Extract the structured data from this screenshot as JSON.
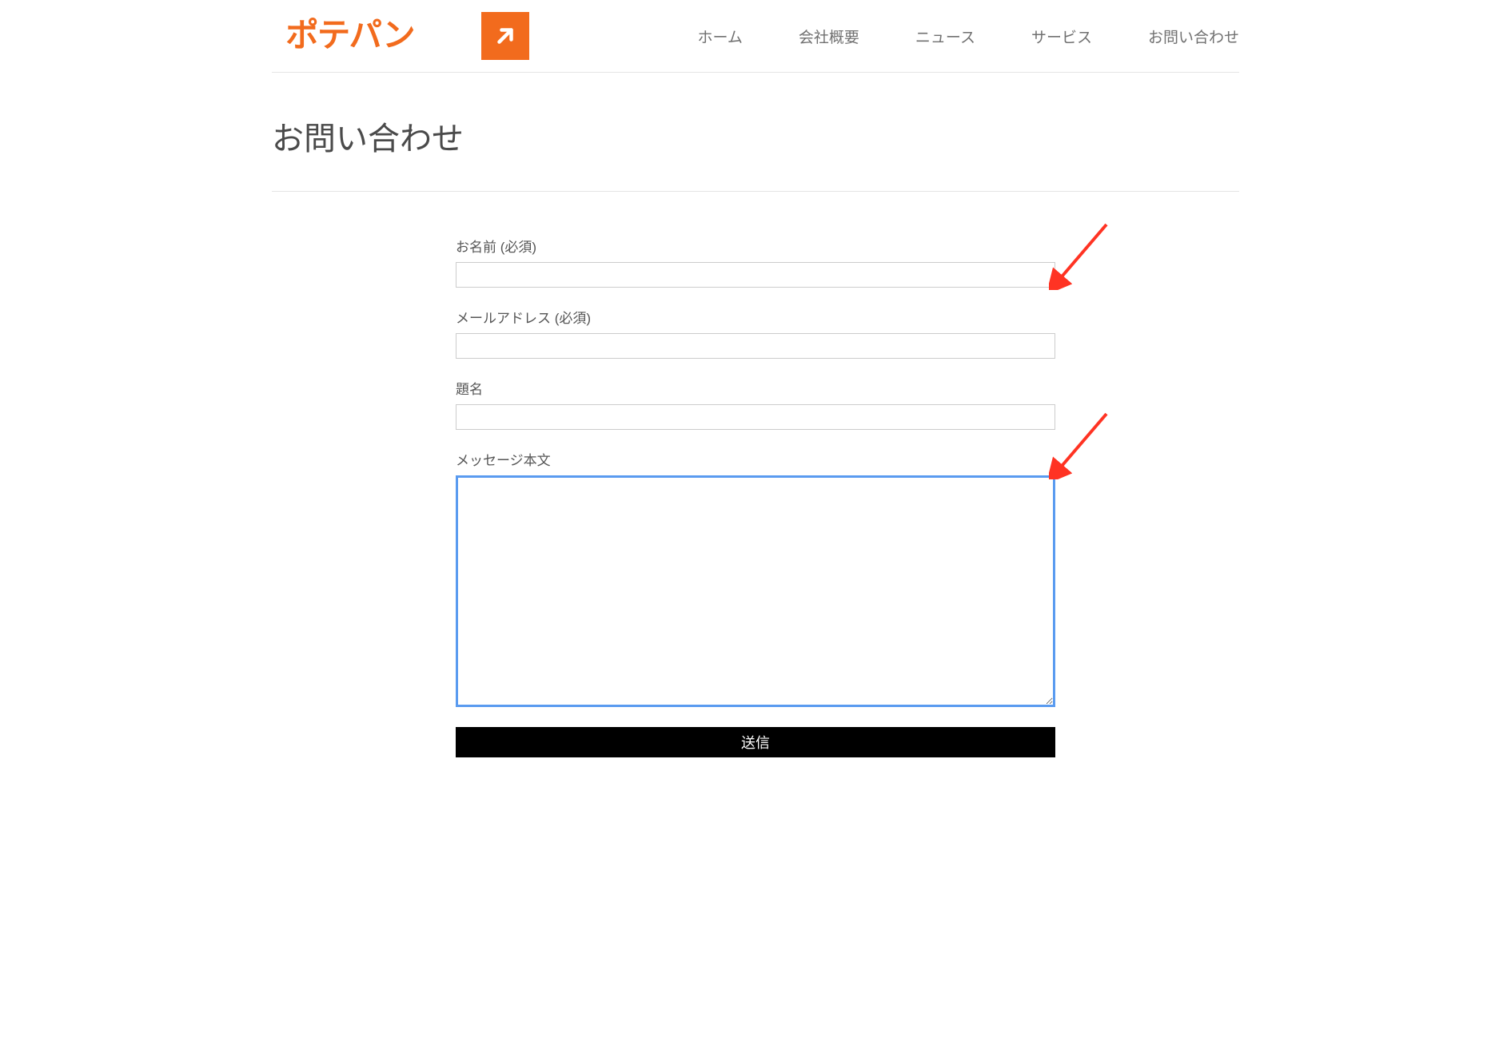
{
  "header": {
    "logo_text": "ポテパン",
    "nav": [
      {
        "label": "ホーム"
      },
      {
        "label": "会社概要"
      },
      {
        "label": "ニュース"
      },
      {
        "label": "サービス"
      },
      {
        "label": "お問い合わせ"
      }
    ]
  },
  "page": {
    "title": "お問い合わせ"
  },
  "form": {
    "name_label": "お名前 (必須)",
    "email_label": "メールアドレス (必須)",
    "subject_label": "題名",
    "message_label": "メッセージ本文",
    "submit_label": "送信"
  },
  "colors": {
    "brand": "#f26b1d",
    "focus": "#5a9bf0",
    "arrow": "#ff3323"
  }
}
